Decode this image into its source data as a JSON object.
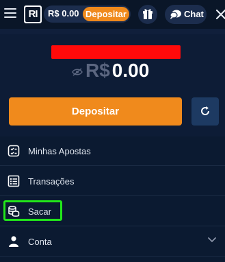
{
  "header": {
    "balance": "R$  0.00",
    "deposit_label": "Depositar",
    "chat_label": "Chat"
  },
  "wallet": {
    "currency": "R$",
    "amount": "0.00",
    "deposit_button": "Depositar"
  },
  "menu": {
    "items": [
      {
        "label": "Minhas Apostas",
        "icon": "bets-icon"
      },
      {
        "label": "Transações",
        "icon": "list-icon"
      },
      {
        "label": "Sacar",
        "icon": "coins-icon"
      },
      {
        "label": "Conta",
        "icon": "user-icon"
      }
    ]
  },
  "colors": {
    "background": "#0d1c36",
    "accent": "#f08a1c",
    "highlight": "#22e61a",
    "redaction": "#ff0a0a"
  }
}
